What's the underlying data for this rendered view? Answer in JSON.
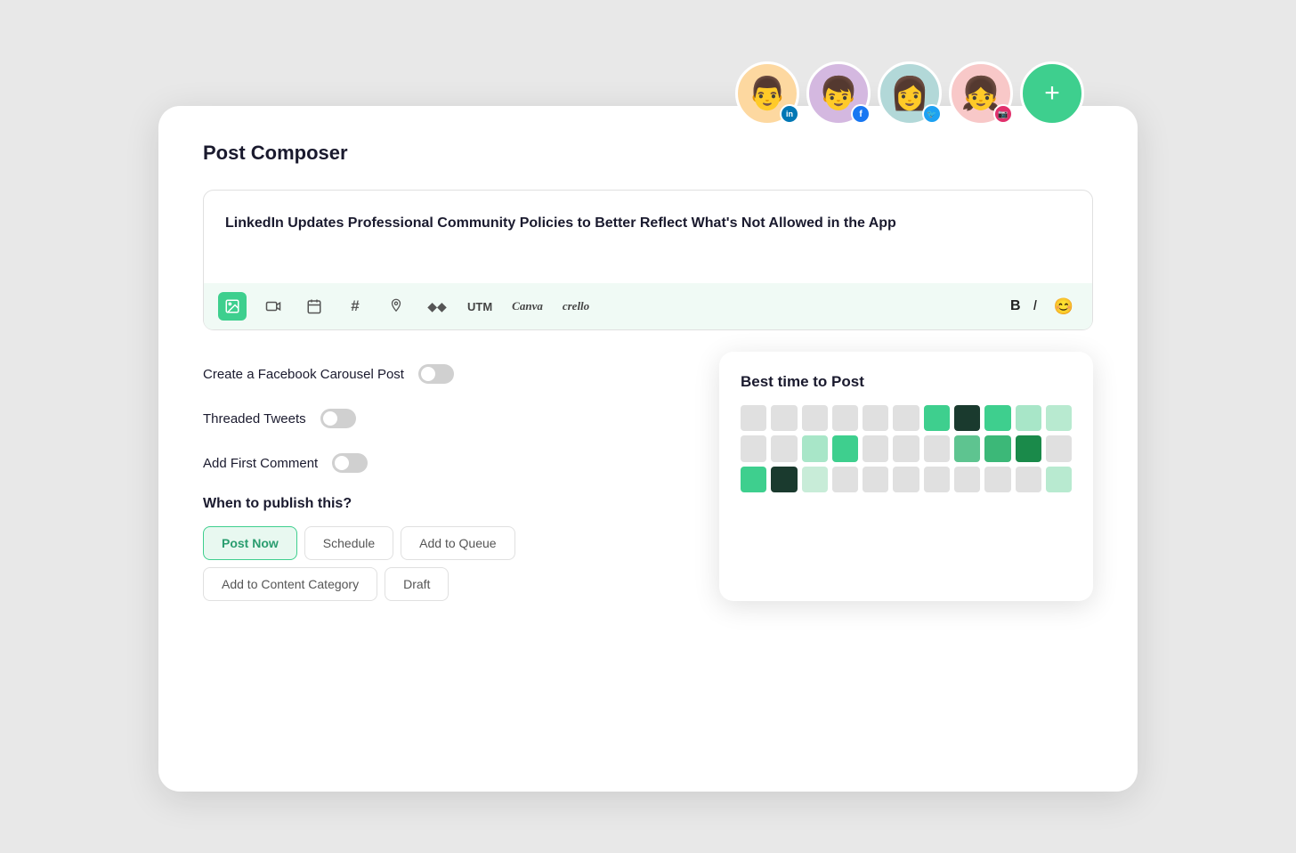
{
  "page": {
    "title": "Post Composer"
  },
  "avatars": [
    {
      "id": "linkedin",
      "emoji": "👨",
      "bg": "#fdd8a0",
      "badge_bg": "#0077b5",
      "badge_icon": "in",
      "label": "LinkedIn avatar"
    },
    {
      "id": "facebook",
      "emoji": "👦",
      "bg": "#d4b8e0",
      "badge_bg": "#1877f2",
      "badge_icon": "f",
      "label": "Facebook avatar"
    },
    {
      "id": "twitter",
      "emoji": "👩",
      "bg": "#b2d8d8",
      "badge_bg": "#1da1f2",
      "badge_icon": "🐦",
      "label": "Twitter avatar"
    },
    {
      "id": "instagram",
      "emoji": "👧",
      "bg": "#f8c8c8",
      "badge_bg": "#e1306c",
      "badge_icon": "📷",
      "label": "Instagram avatar"
    }
  ],
  "add_account_label": "+",
  "editor": {
    "content": "LinkedIn Updates Professional Community Policies to Better Reflect What's Not Allowed in the App",
    "toolbar": {
      "image_icon": "🖼",
      "video_icon": "🎬",
      "calendar_icon": "🗂",
      "hashtag_icon": "#",
      "location_icon": "📍",
      "diamond_icon": "◆◆",
      "utm_label": "UTM",
      "canva_label": "Canva",
      "crello_label": "crello",
      "bold_label": "B",
      "italic_label": "I",
      "emoji_icon": "😊"
    }
  },
  "options": [
    {
      "id": "facebook-carousel",
      "label": "Create a Facebook Carousel Post",
      "enabled": false
    },
    {
      "id": "threaded-tweets",
      "label": "Threaded Tweets",
      "enabled": false
    },
    {
      "id": "first-comment",
      "label": "Add First Comment",
      "enabled": false
    }
  ],
  "publish": {
    "label": "When to publish this?",
    "buttons": [
      {
        "id": "post-now",
        "label": "Post Now",
        "active": true
      },
      {
        "id": "schedule",
        "label": "Schedule",
        "active": false
      },
      {
        "id": "add-to-queue",
        "label": "Add to Queue",
        "active": false
      },
      {
        "id": "add-to-content-category",
        "label": "Add to Content Category",
        "active": false
      },
      {
        "id": "draft",
        "label": "Draft",
        "active": false
      }
    ]
  },
  "best_time": {
    "title": "Best time to Post",
    "heatmap": [
      [
        "#e0e0e0",
        "#e0e0e0",
        "#e0e0e0",
        "#e0e0e0",
        "#e0e0e0",
        "#e0e0e0",
        "#3ecf8e",
        "#1a3a2e",
        "#3ecf8e",
        "#a8e6c8",
        "#b8ead0"
      ],
      [
        "#e0e0e0",
        "#e0e0e0",
        "#a8e6c8",
        "#3ecf8e",
        "#e0e0e0",
        "#e0e0e0",
        "#e0e0e0",
        "#5ec490",
        "#3cb878",
        "#1a8a4a",
        "#e0e0e0"
      ],
      [
        "#3ecf8e",
        "#1a3a2e",
        "#c8ecd8",
        "#e0e0e0",
        "#e0e0e0",
        "#e0e0e0",
        "#e0e0e0",
        "#e0e0e0",
        "#e0e0e0",
        "#e0e0e0",
        "#b8ead0"
      ]
    ]
  }
}
